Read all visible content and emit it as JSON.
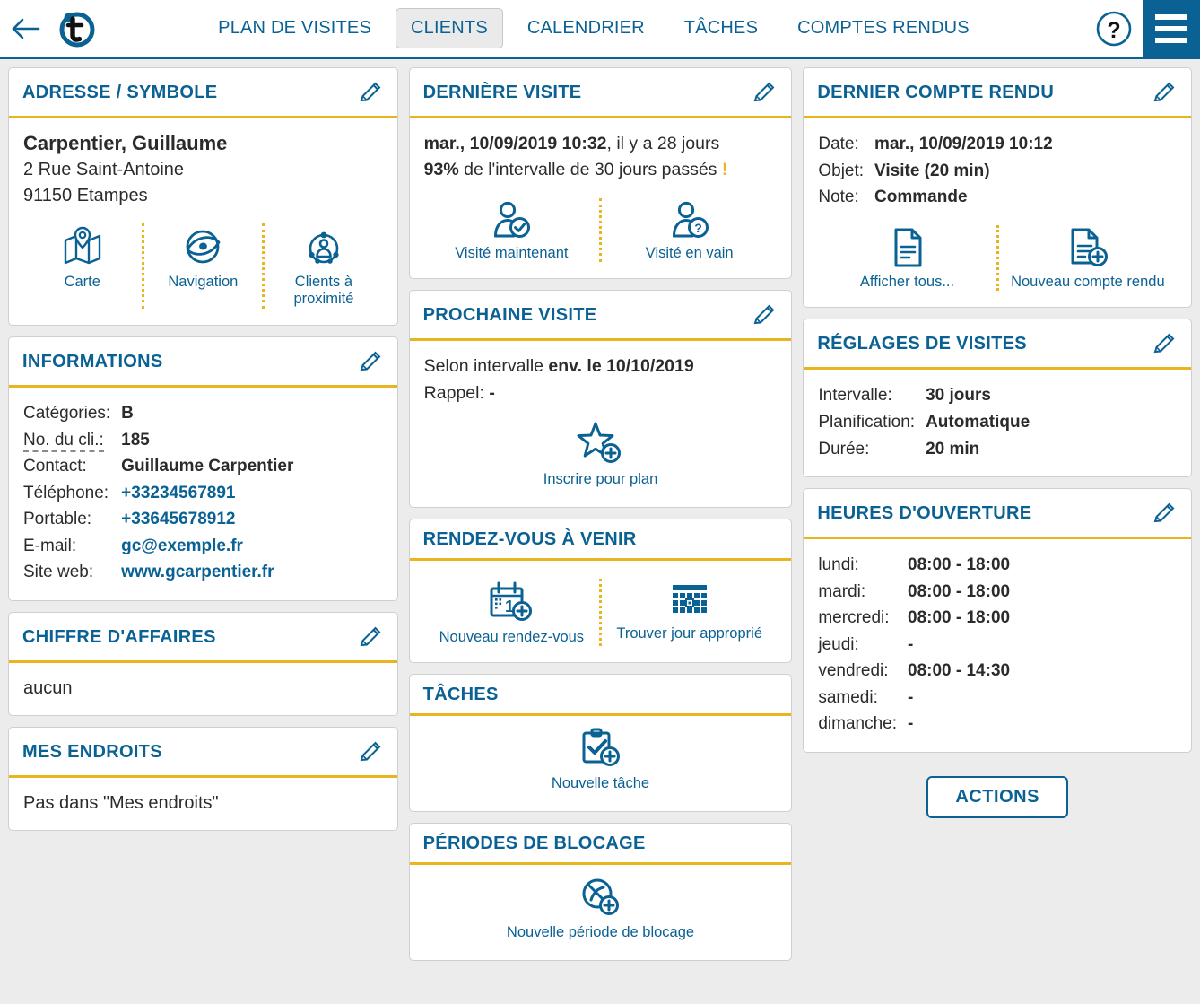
{
  "header": {
    "back_icon": "arrow-left-icon",
    "logo": "t-logo",
    "tabs": [
      {
        "label": "PLAN DE VISITES",
        "active": false
      },
      {
        "label": "CLIENTS",
        "active": true
      },
      {
        "label": "CALENDRIER",
        "active": false
      },
      {
        "label": "TÂCHES",
        "active": false
      },
      {
        "label": "COMPTES RENDUS",
        "active": false
      }
    ],
    "help_icon": "question-mark-icon",
    "menu_icon": "hamburger-menu-icon"
  },
  "colors": {
    "accent_blue": "#0a6193",
    "accent_gold": "#e8b51e",
    "background": "#ececec"
  },
  "address_card": {
    "title": "ADRESSE / SYMBOLE",
    "edit_icon": "pencil-icon",
    "name": "Carpentier, Guillaume",
    "street": "2 Rue Saint-Antoine",
    "city": "91150 Etampes",
    "actions": [
      {
        "label": "Carte",
        "icon": "map-icon"
      },
      {
        "label": "Navigation",
        "icon": "navigation-compass-icon"
      },
      {
        "label": "Clients à proximité",
        "icon": "nearby-clients-icon"
      }
    ]
  },
  "information_card": {
    "title": "INFORMATIONS",
    "edit_icon": "pencil-icon",
    "rows": [
      {
        "key": "Catégories:",
        "value": "B",
        "style": "bold",
        "dotted": false
      },
      {
        "key": "No. du cli.:",
        "value": "185",
        "style": "bold",
        "dotted": true
      },
      {
        "key": "Contact:",
        "value": "Guillaume Carpentier",
        "style": "bold",
        "dotted": false
      },
      {
        "key": "Téléphone:",
        "value": "+33234567891",
        "style": "link",
        "dotted": false
      },
      {
        "key": "Portable:",
        "value": "+33645678912",
        "style": "link",
        "dotted": false
      },
      {
        "key": "E-mail:",
        "value": "gc@exemple.fr",
        "style": "link",
        "dotted": false
      },
      {
        "key": "Site web:",
        "value": "www.gcarpentier.fr",
        "style": "link",
        "dotted": false
      }
    ]
  },
  "revenue_card": {
    "title": "CHIFFRE D'AFFAIRES",
    "edit_icon": "pencil-icon",
    "body": "aucun"
  },
  "places_card": {
    "title": "MES ENDROITS",
    "edit_icon": "pencil-icon",
    "body": "Pas dans \"Mes endroits\""
  },
  "last_visit_card": {
    "title": "DERNIÈRE VISITE",
    "edit_icon": "pencil-icon",
    "line1_bold": "mar., 10/09/2019 10:32",
    "line1_rest": ", il y a 28 jours",
    "line2_bold": "93%",
    "line2_rest": " de l'intervalle de 30 jours passés ",
    "line2_warning": "!",
    "actions": [
      {
        "label": "Visité maintenant",
        "icon": "user-check-icon"
      },
      {
        "label": "Visité en vain",
        "icon": "user-question-icon"
      }
    ]
  },
  "next_visit_card": {
    "title": "PROCHAINE VISITE",
    "edit_icon": "pencil-icon",
    "line1_prefix": "Selon intervalle ",
    "line1_bold": "env. le 10/10/2019",
    "line2_prefix": "Rappel: ",
    "line2_bold": "-",
    "action": {
      "label": "Inscrire pour plan",
      "icon": "star-plus-icon"
    }
  },
  "appointments_card": {
    "title": "RENDEZ-VOUS À VENIR",
    "actions": [
      {
        "label": "Nouveau rendez-vous",
        "icon": "calendar-plus-icon"
      },
      {
        "label": "Trouver jour approprié",
        "icon": "calendar-grid-icon"
      }
    ]
  },
  "tasks_card": {
    "title": "TÂCHES",
    "action": {
      "label": "Nouvelle tâche",
      "icon": "clipboard-check-plus-icon"
    }
  },
  "blocking_card": {
    "title": "PÉRIODES DE BLOCAGE",
    "action": {
      "label": "Nouvelle période de blocage",
      "icon": "block-plus-icon"
    }
  },
  "last_report_card": {
    "title": "DERNIER COMPTE RENDU",
    "edit_icon": "pencil-icon",
    "rows": [
      {
        "key": "Date:",
        "value": "mar., 10/09/2019 10:12"
      },
      {
        "key": "Objet:",
        "value": "Visite (20 min)"
      },
      {
        "key": "Note:",
        "value": "Commande"
      }
    ],
    "actions": [
      {
        "label": "Afficher tous...",
        "icon": "document-icon"
      },
      {
        "label": "Nouveau compte rendu",
        "icon": "document-plus-icon"
      }
    ]
  },
  "visit_settings_card": {
    "title": "RÉGLAGES DE VISITES",
    "edit_icon": "pencil-icon",
    "rows": [
      {
        "key": "Intervalle:",
        "value": "30 jours"
      },
      {
        "key": "Planification:",
        "value": "Automatique"
      },
      {
        "key": "Durée:",
        "value": "20 min"
      }
    ]
  },
  "opening_hours_card": {
    "title": "HEURES D'OUVERTURE",
    "edit_icon": "pencil-icon",
    "rows": [
      {
        "key": "lundi:",
        "value": "08:00 - 18:00"
      },
      {
        "key": "mardi:",
        "value": "08:00 - 18:00"
      },
      {
        "key": "mercredi:",
        "value": "08:00 - 18:00"
      },
      {
        "key": "jeudi:",
        "value": "-"
      },
      {
        "key": "vendredi:",
        "value": "08:00 - 14:30"
      },
      {
        "key": "samedi:",
        "value": "-"
      },
      {
        "key": "dimanche:",
        "value": "-"
      }
    ]
  },
  "actions_button": {
    "label": "ACTIONS"
  }
}
